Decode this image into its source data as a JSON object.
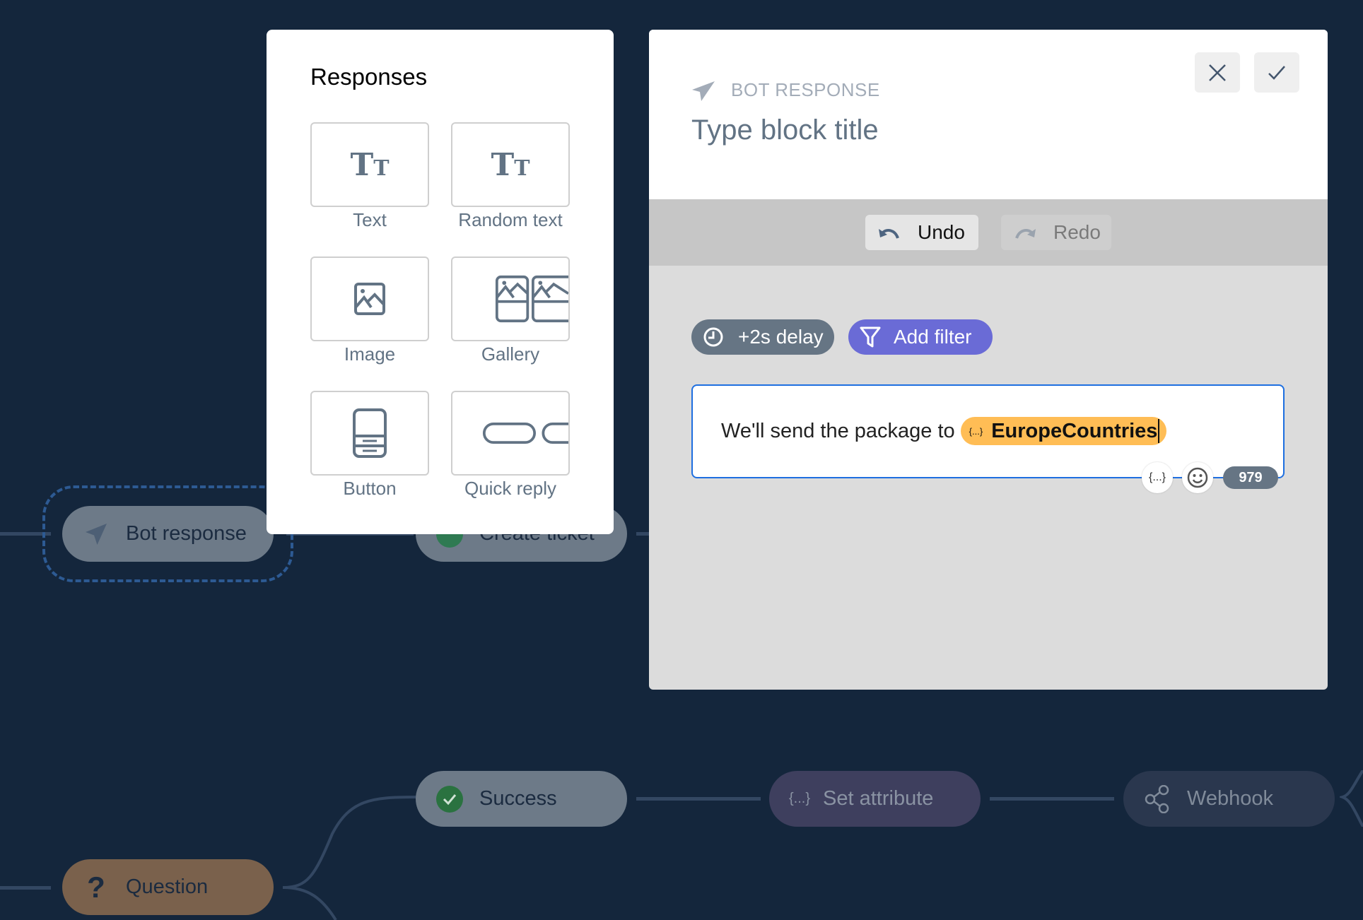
{
  "canvas": {
    "nodes": [
      {
        "id": "bot-response",
        "label": "Bot response",
        "icon": "paper-plane-icon",
        "selected": true
      },
      {
        "id": "create-ticket",
        "label": "Create ticket",
        "icon": "ticket-icon"
      },
      {
        "id": "success",
        "label": "Success",
        "icon": "check-circle-icon"
      },
      {
        "id": "set-attribute",
        "label": "Set attribute",
        "icon": "braces-icon",
        "icon_text": "{...}"
      },
      {
        "id": "webhook",
        "label": "Webhook",
        "icon": "share-icon"
      },
      {
        "id": "question",
        "label": "Question",
        "icon": "question-icon",
        "icon_text": "?"
      }
    ]
  },
  "responses": {
    "title": "Responses",
    "items": [
      {
        "label": "Text",
        "icon": "text-format-icon",
        "icon_text": "Tт"
      },
      {
        "label": "Random text",
        "icon": "text-format-icon",
        "icon_text": "Tт"
      },
      {
        "label": "Image",
        "icon": "image-icon"
      },
      {
        "label": "Gallery",
        "icon": "gallery-icon"
      },
      {
        "label": "Button",
        "icon": "button-icon"
      },
      {
        "label": "Quick reply",
        "icon": "quick-reply-icon"
      }
    ]
  },
  "editor": {
    "type_label": "BOT RESPONSE",
    "title_placeholder": "Type block title",
    "toolbar": {
      "undo": "Undo",
      "redo": "Redo"
    },
    "delay_label": "+2s delay",
    "filter_label": "Add filter",
    "message": {
      "text": "We'll send the package to",
      "variable_icon_text": "{...}",
      "variable": "EuropeCountries"
    },
    "insert_variable_text": "{...}",
    "char_count": "979",
    "colors": {
      "accent": "#6a6bd6",
      "delay": "#667584",
      "variable_chip": "#ffbd55",
      "focus_border": "#1e6fe0"
    }
  }
}
